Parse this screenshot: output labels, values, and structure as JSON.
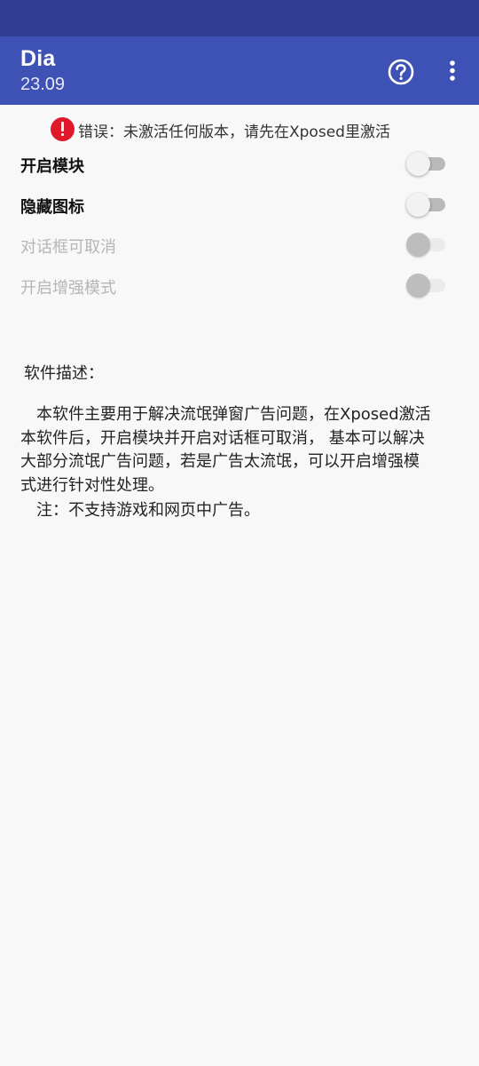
{
  "app_bar": {
    "title": "Dia",
    "subtitle": "23.09",
    "help_icon": "help-circle-icon",
    "more_icon": "more-vertical-icon"
  },
  "error": {
    "icon": "error-icon",
    "text": "错误：未激活任何版本，请先在Xposed里激活"
  },
  "settings": [
    {
      "label": "开启模块",
      "enabled": true,
      "checked": false
    },
    {
      "label": "隐藏图标",
      "enabled": true,
      "checked": false
    },
    {
      "label": "对话框可取消",
      "enabled": false,
      "checked": false
    },
    {
      "label": "开启增强模式",
      "enabled": false,
      "checked": false
    }
  ],
  "description": {
    "title": "软件描述：",
    "lines": [
      "　本软件主要用于解决流氓弹窗广告问题，在Xposed激活",
      "本软件后，开启模块并开启对话框可取消， 基本可以解决",
      "大部分流氓广告问题，若是广告太流氓，可以开启增强模",
      "式进行针对性处理。"
    ],
    "note": "　注：不支持游戏和网页中广告。"
  },
  "colors": {
    "status_bar": "#2f3d93",
    "app_bar": "#3e51b5",
    "error": "#e0182a",
    "background": "#f8f8f8"
  }
}
